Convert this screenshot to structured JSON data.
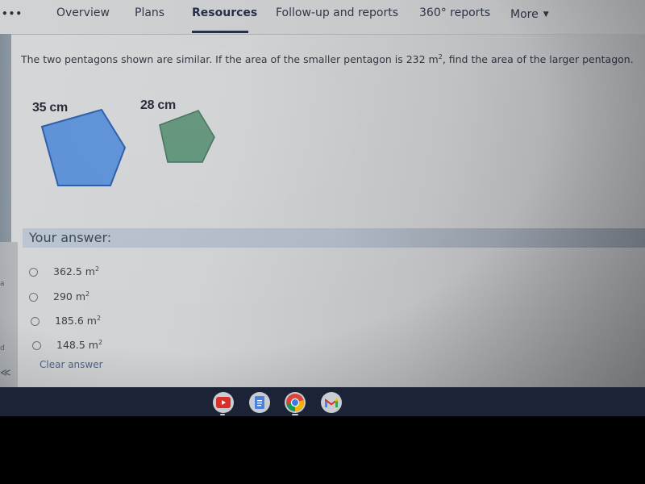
{
  "nav": {
    "overflow_label": "•••",
    "tabs": [
      {
        "label": "Overview",
        "active": false
      },
      {
        "label": "Plans",
        "active": false
      },
      {
        "label": "Resources",
        "active": true
      },
      {
        "label": "Follow-up and reports",
        "active": false
      },
      {
        "label": "360° reports",
        "active": false
      },
      {
        "label": "More",
        "active": false
      }
    ],
    "more_caret": "▼"
  },
  "question": {
    "text_before": "The two pentagons shown are similar.  If the area of the smaller pentagon is 232 m",
    "superscript": "2",
    "text_after": ", find the area of the larger pentagon."
  },
  "figures": {
    "large": {
      "label": "35 cm",
      "fill": "#5b8fd6",
      "stroke": "#2a5aa8"
    },
    "small": {
      "label": "28 cm",
      "fill": "#5e9278",
      "stroke": "#3f6e57"
    }
  },
  "answer": {
    "label": "Your answer:",
    "options": [
      {
        "value": "362.5 m",
        "sup": "2",
        "selected": false
      },
      {
        "value": "290 m",
        "sup": "2",
        "selected": false
      },
      {
        "value": "185.6 m",
        "sup": "2",
        "selected": false
      },
      {
        "value": "148.5 m",
        "sup": "2",
        "selected": false
      }
    ],
    "clear_label": "Clear answer"
  },
  "left_rail": {
    "fragment_1": "a",
    "fragment_2": "d",
    "collapse_glyph": "≪"
  },
  "shelf": {
    "apps": [
      {
        "name": "YouTube",
        "color": "#d8302a",
        "running": true
      },
      {
        "name": "Docs",
        "color": "#4a82e0",
        "running": false
      },
      {
        "name": "Chrome",
        "color": "#3b7de0",
        "running": true
      },
      {
        "name": "Gmail",
        "color": "#d8302a",
        "running": false
      }
    ]
  }
}
